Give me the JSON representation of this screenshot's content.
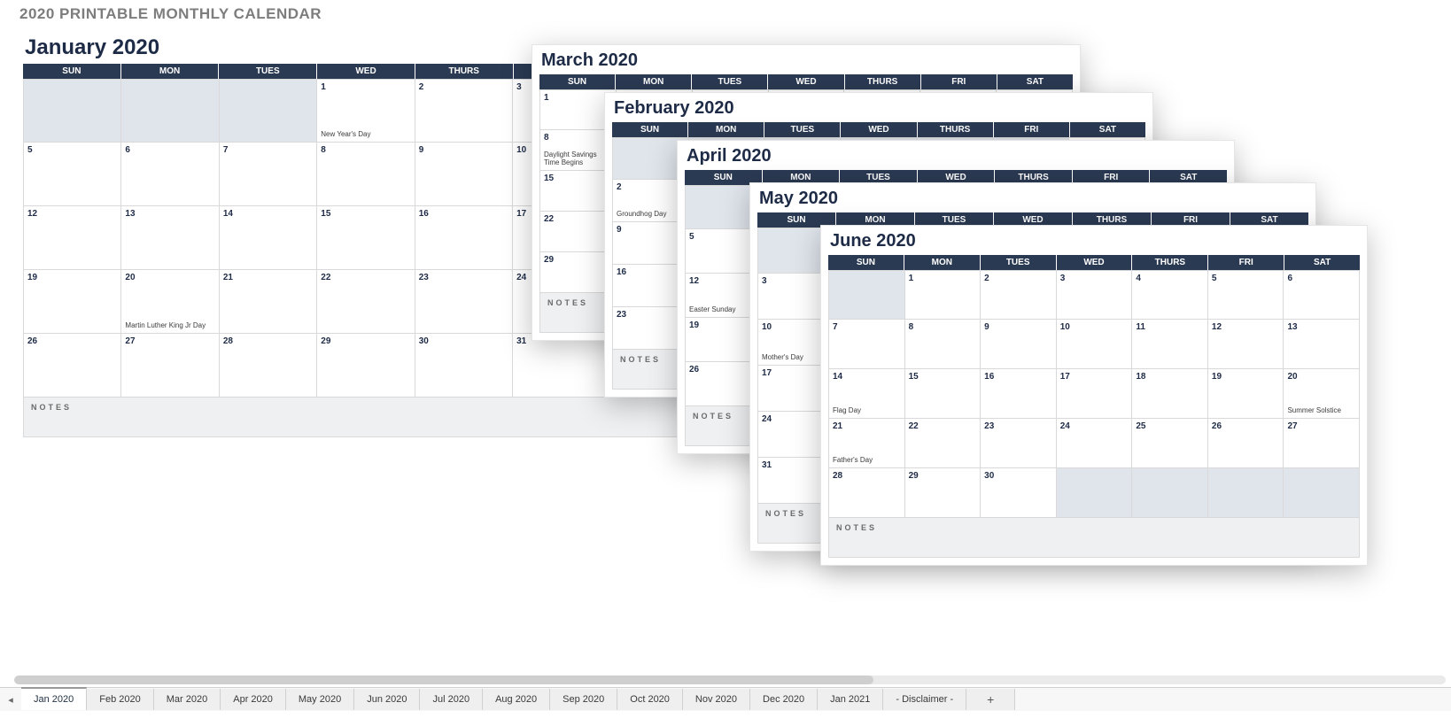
{
  "page_title": "2020 PRINTABLE MONTHLY CALENDAR",
  "weekdays": [
    "SUN",
    "MON",
    "TUES",
    "WED",
    "THURS",
    "FRI",
    "SAT"
  ],
  "notes_label": "NOTES",
  "months": {
    "jan": {
      "title": "January 2020",
      "lead_blank": 3,
      "days": 31,
      "trail_blank": 1,
      "rows": 5,
      "events": {
        "1": "New Year's Day",
        "20": "Martin Luther King Jr Day"
      }
    },
    "feb": {
      "title": "February 2020",
      "lead_blank": 6,
      "days": 29,
      "trail_blank": 0,
      "rows": 5,
      "events": {
        "2": "Groundhog Day"
      }
    },
    "mar": {
      "title": "March 2020",
      "lead_blank": 0,
      "days": 31,
      "trail_blank": 4,
      "rows": 5,
      "events": {
        "8": "Daylight Savings Time Begins"
      }
    },
    "apr": {
      "title": "April 2020",
      "lead_blank": 3,
      "days": 30,
      "trail_blank": 2,
      "rows": 5,
      "events": {
        "12": "Easter Sunday"
      }
    },
    "may": {
      "title": "May 2020",
      "lead_blank": 5,
      "days": 31,
      "trail_blank": 6,
      "rows": 6,
      "events": {
        "10": "Mother's Day"
      }
    },
    "jun": {
      "title": "June 2020",
      "lead_blank": 1,
      "days": 30,
      "trail_blank": 4,
      "rows": 5,
      "events": {
        "14": "Flag Day",
        "20": "Summer Solstice",
        "21": "Father's Day"
      }
    }
  },
  "tabs": [
    "Jan 2020",
    "Feb 2020",
    "Mar 2020",
    "Apr 2020",
    "May 2020",
    "Jun 2020",
    "Jul 2020",
    "Aug 2020",
    "Sep 2020",
    "Oct 2020",
    "Nov 2020",
    "Dec 2020",
    "Jan 2021",
    "- Disclaimer -"
  ],
  "active_tab": 0,
  "nav_prev": "◂",
  "add_tab": "+"
}
